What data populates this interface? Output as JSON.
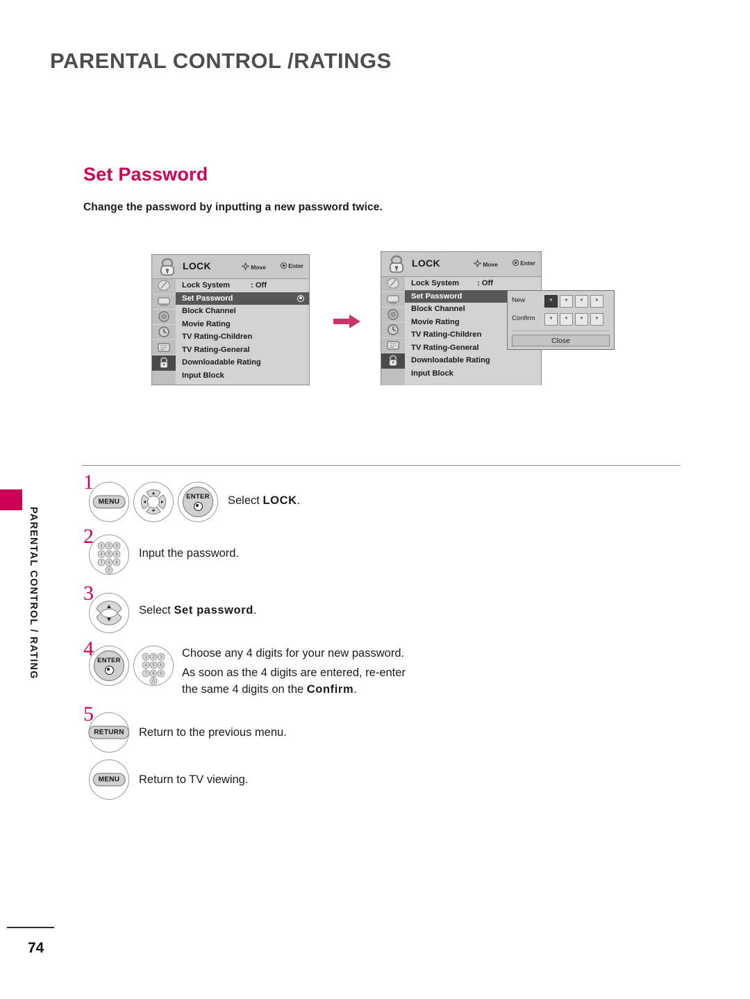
{
  "page": {
    "title": "PARENTAL CONTROL /RATINGS",
    "number": "74",
    "side_tab": "PARENTAL CONTROL / RATING",
    "accent_color": "#cc0055",
    "title_color": "#4d4d4d"
  },
  "section": {
    "heading": "Set Password",
    "description": "Change the password by inputting a new password twice."
  },
  "osd": {
    "header": {
      "title": "LOCK",
      "move_label": "Move",
      "enter_label": "Enter",
      "lock_icon": "lock-icon",
      "move_icon": "four-way-arrow-icon",
      "enter_icon": "enter-dot-icon"
    },
    "rail_icons": [
      "picture-setup-icon",
      "screen-tv-icon",
      "audio-dial-icon",
      "time-clock-icon",
      "option-icon",
      "lock-icon"
    ],
    "rail_active_index": 5,
    "items": [
      {
        "label": "Lock System",
        "value": ": Off",
        "selected": false,
        "radio": false
      },
      {
        "label": "Set Password",
        "value": "",
        "selected": true,
        "radio": true
      },
      {
        "label": "Block Channel",
        "value": "",
        "selected": false,
        "radio": false
      },
      {
        "label": "Movie Rating",
        "value": "",
        "selected": false,
        "radio": false
      },
      {
        "label": "TV Rating-Children",
        "value": "",
        "selected": false,
        "radio": false
      },
      {
        "label": "TV Rating-General",
        "value": "",
        "selected": false,
        "radio": false
      },
      {
        "label": "Downloadable Rating",
        "value": "",
        "selected": false,
        "radio": false
      },
      {
        "label": "Input Block",
        "value": "",
        "selected": false,
        "radio": false
      }
    ]
  },
  "osd2": {
    "items": [
      {
        "label": "Lock System",
        "value": ": Off",
        "selected": false,
        "radio": false
      },
      {
        "label": "Set Password",
        "value": "",
        "selected": true,
        "radio": false
      },
      {
        "label": "Block Channel",
        "value": "",
        "selected": false,
        "radio": false
      },
      {
        "label": "Movie Rating",
        "value": "",
        "selected": false,
        "radio": false
      },
      {
        "label": "TV Rating-Children",
        "value": "",
        "selected": false,
        "radio": false
      },
      {
        "label": "TV Rating-General",
        "value": "",
        "selected": false,
        "radio": false
      },
      {
        "label": "Downloadable Rating",
        "value": "",
        "selected": false,
        "radio": false
      },
      {
        "label": "Input Block",
        "value": "",
        "selected": false,
        "radio": false
      }
    ]
  },
  "password_popup": {
    "new_label": "New",
    "confirm_label": "Confirm",
    "new_digits": [
      "*",
      "*",
      "*",
      "*"
    ],
    "confirm_digits": [
      "*",
      "*",
      "*",
      "*"
    ],
    "focused_field": "new-digit-1",
    "close_label": "Close"
  },
  "flow": {
    "arrow_icon": "right-arrow-icon",
    "arrow_color": "#cc0055"
  },
  "steps": [
    {
      "number": "1",
      "buttons": [
        "MENU",
        "four-way-nav",
        "ENTER"
      ],
      "menu_label": "MENU",
      "enter_label": "ENTER",
      "text_prefix": "Select ",
      "text_bold": "LOCK",
      "text_suffix": "."
    },
    {
      "number": "2",
      "buttons": [
        "number-keypad"
      ],
      "text_prefix": "Input the password.",
      "text_bold": "",
      "text_suffix": ""
    },
    {
      "number": "3",
      "buttons": [
        "up-down-nav"
      ],
      "text_prefix": "Select ",
      "text_bold": "Set password",
      "text_suffix": "."
    },
    {
      "number": "4",
      "buttons": [
        "ENTER",
        "number-keypad"
      ],
      "enter_label": "ENTER",
      "line1": "Choose any 4 digits for your new password.",
      "line2": "As soon as the 4 digits are entered, re-enter",
      "line3_prefix": "the same 4 digits on the ",
      "line3_bold": "Confirm",
      "line3_suffix": "."
    },
    {
      "number": "5",
      "buttons": [
        "RETURN"
      ],
      "return_label": "RETURN",
      "text_prefix": "Return to the previous menu.",
      "text_bold": "",
      "text_suffix": ""
    },
    {
      "number": "",
      "buttons": [
        "MENU"
      ],
      "menu_label": "MENU",
      "text_prefix": "Return to TV viewing.",
      "text_bold": "",
      "text_suffix": ""
    }
  ]
}
